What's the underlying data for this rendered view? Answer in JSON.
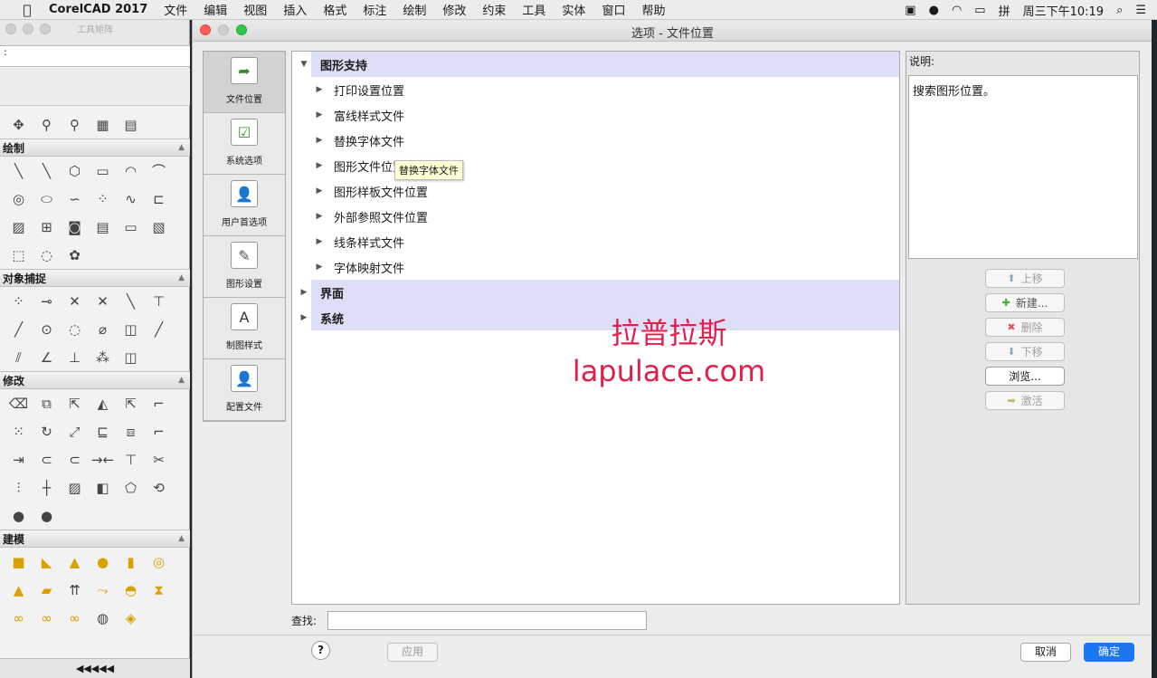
{
  "menubar": {
    "app_name": "CorelCAD 2017",
    "items": [
      "文件",
      "编辑",
      "视图",
      "插入",
      "格式",
      "标注",
      "绘制",
      "修改",
      "约束",
      "工具",
      "实体",
      "窗口",
      "帮助"
    ],
    "clock": "周三下午10:19"
  },
  "toolbox": {
    "title": "工具矩阵",
    "command_prompt": ":",
    "sections": {
      "draw": "绘制",
      "snap": "对象捕捉",
      "modify": "修改",
      "model": "建模"
    },
    "bottom_label": "◀◀◀◀◀"
  },
  "dialog": {
    "title": "选项 - 文件位置",
    "categories": [
      {
        "label": "文件位置",
        "icon": "file-location-icon"
      },
      {
        "label": "系统选项",
        "icon": "system-options-icon"
      },
      {
        "label": "用户首选项",
        "icon": "user-preferences-icon"
      },
      {
        "label": "图形设置",
        "icon": "drawing-settings-icon"
      },
      {
        "label": "制图样式",
        "icon": "drafting-styles-icon"
      },
      {
        "label": "配置文件",
        "icon": "profiles-icon"
      }
    ],
    "tree": {
      "graphics_support": "图形支持",
      "children": [
        "打印设置位置",
        "富线样式文件",
        "替换字体文件",
        "图形文件位置",
        "图形样板文件位置",
        "外部参照文件位置",
        "线条样式文件",
        "字体映射文件"
      ],
      "interface": "界面",
      "system": "系统"
    },
    "tooltip": "替换字体文件",
    "description_label": "说明:",
    "description_text": "搜索图形位置。",
    "buttons": {
      "move_up": "上移",
      "new": "新建...",
      "delete": "删除",
      "move_down": "下移",
      "browse": "浏览...",
      "activate": "激活"
    },
    "search_label": "查找:",
    "search_value": "",
    "help": "?",
    "apply": "应用",
    "cancel": "取消",
    "ok": "确定"
  },
  "watermark": {
    "line1": "拉普拉斯",
    "line2": "lapulace.com"
  }
}
